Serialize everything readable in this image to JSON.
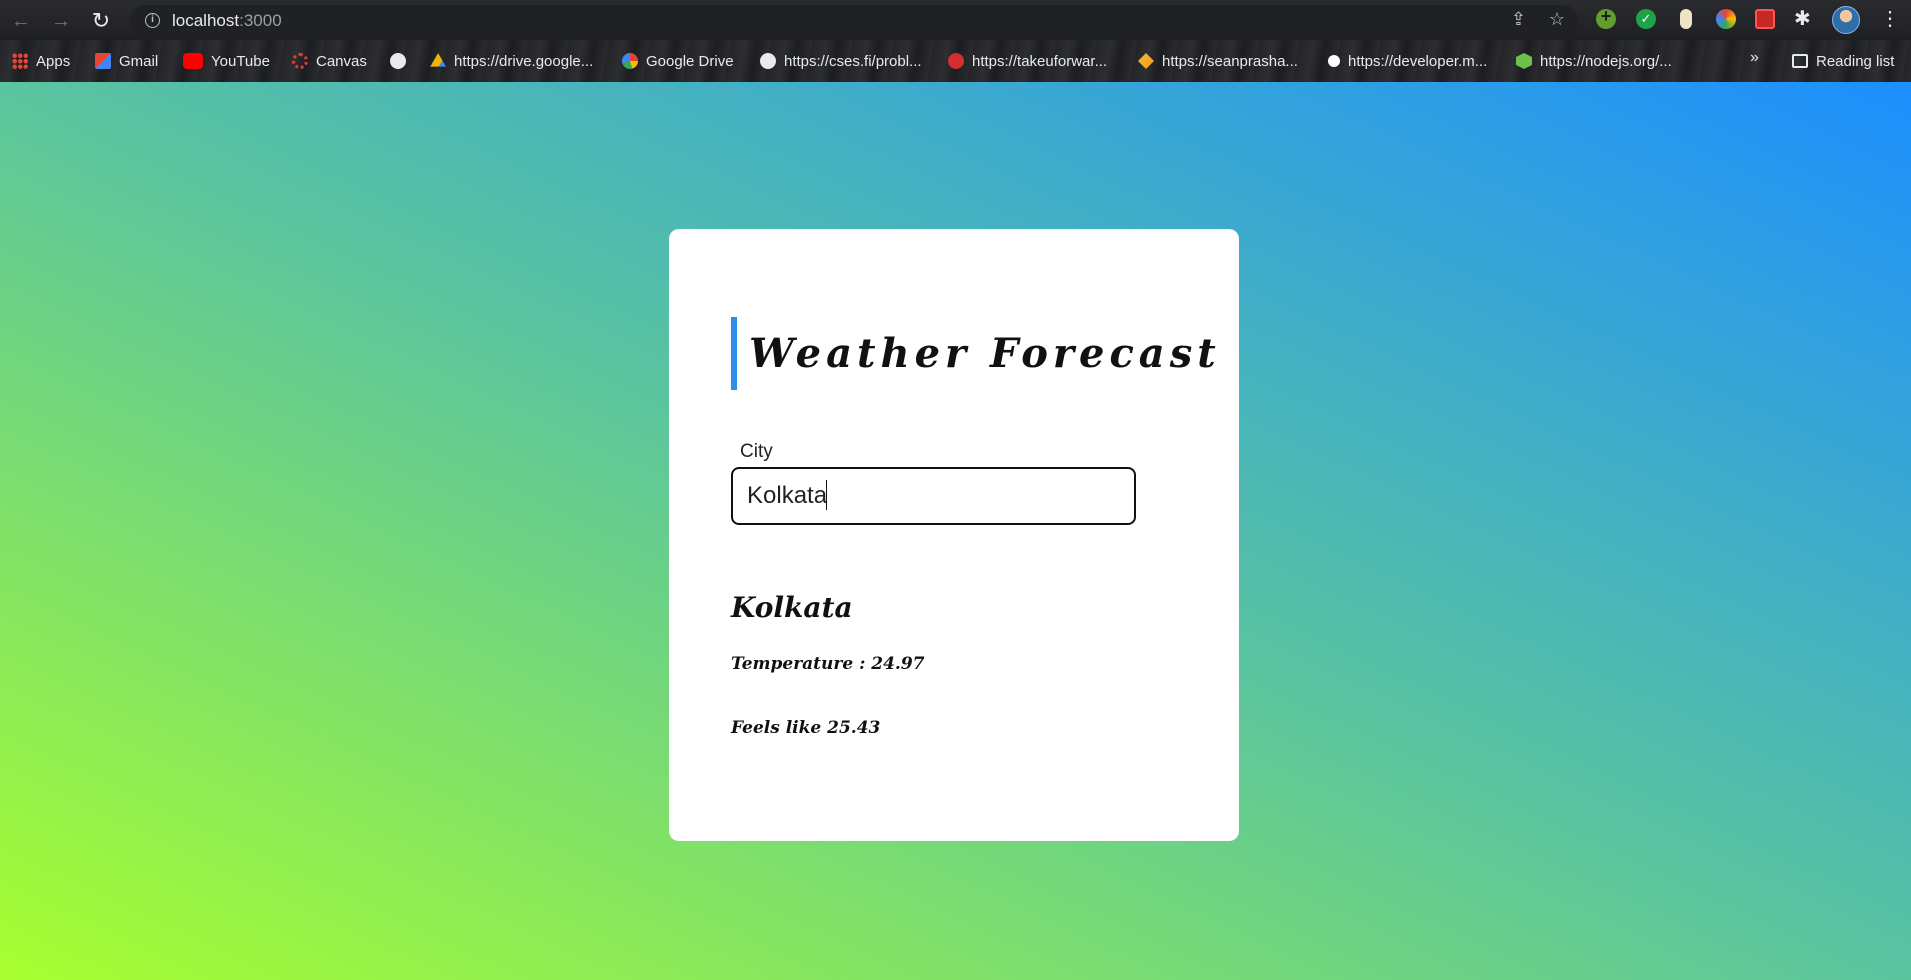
{
  "browser": {
    "url_host": "localhost",
    "url_port": ":3000",
    "bookmarks": [
      {
        "label": "Apps",
        "icon": "apps-icon"
      },
      {
        "label": "Gmail",
        "icon": "gmail-icon"
      },
      {
        "label": "YouTube",
        "icon": "youtube-icon"
      },
      {
        "label": "Canvas",
        "icon": "canvas-icon"
      },
      {
        "label": "",
        "icon": "globe-icon"
      },
      {
        "label": "https://drive.google...",
        "icon": "google-drive-icon"
      },
      {
        "label": "Google Drive",
        "icon": "google-icon"
      },
      {
        "label": "https://cses.fi/probl...",
        "icon": "globe-icon"
      },
      {
        "label": "https://takeuforwar...",
        "icon": "tuf-icon"
      },
      {
        "label": "https://seanprasha...",
        "icon": "sean-icon"
      },
      {
        "label": "https://developer.m...",
        "icon": "developer-icon"
      },
      {
        "label": "https://nodejs.org/...",
        "icon": "node-icon"
      }
    ],
    "overflow_label": "»",
    "reading_list_label": "Reading list"
  },
  "app": {
    "title": "Weather Forecast",
    "city_label": "City",
    "city_value": "Kolkata",
    "result": {
      "city": "Kolkata",
      "temperature_text": "Temperature : 24.97",
      "feels_like_text": "Feels like 25.43"
    }
  },
  "colors": {
    "accent_bar": "#2d8fe8",
    "gradient_start": "#a8ff2f",
    "gradient_end": "#1d8fff"
  }
}
